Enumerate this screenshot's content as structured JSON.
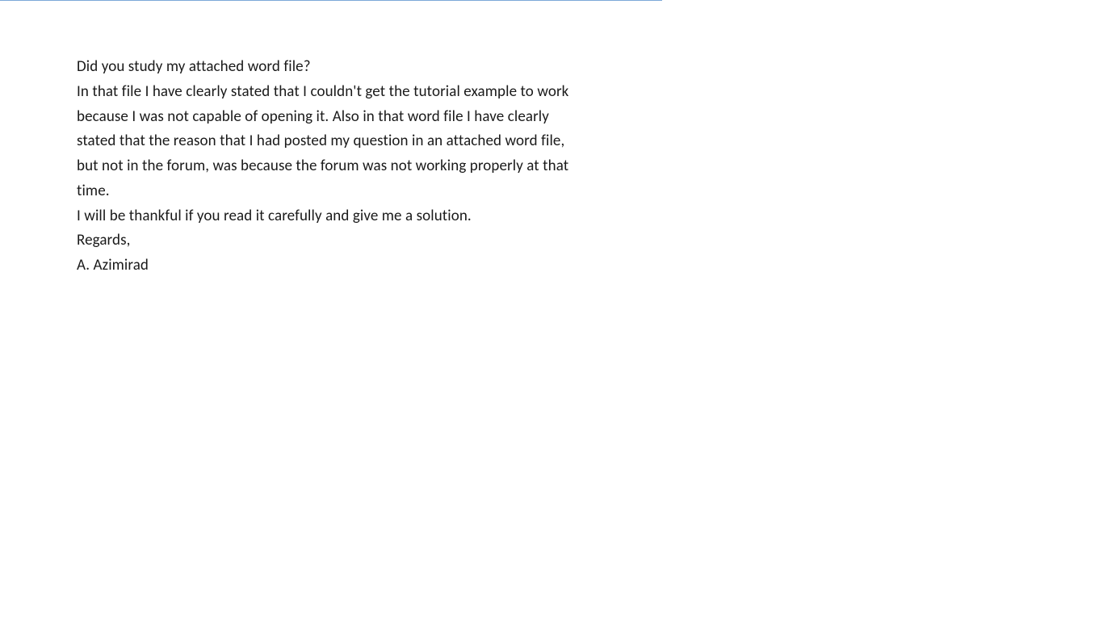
{
  "document": {
    "paragraphs": [
      "Did you study my attached word file?",
      "In that file I have clearly stated that I couldn't get the tutorial example to work because I was not capable of opening it. Also in that word file I have clearly stated that the reason that I had posted my question in an attached word file, but not in the forum, was because the forum was not working properly at that time.",
      "I will be thankful if you read it carefully and give me a solution.",
      "Regards,",
      "A. Azimirad"
    ]
  }
}
